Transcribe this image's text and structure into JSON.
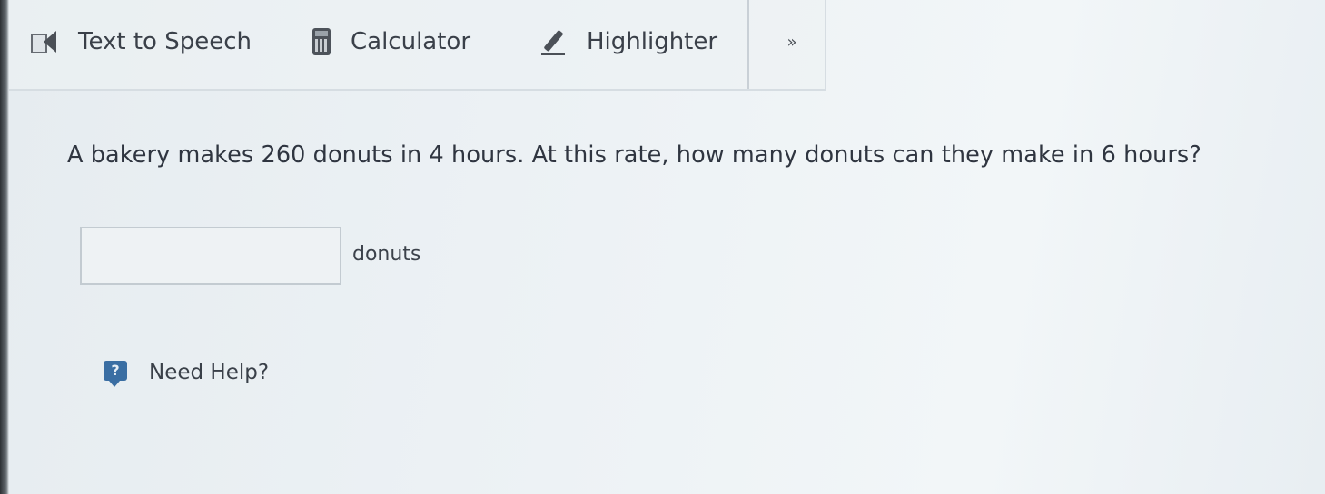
{
  "toolbar": {
    "text_to_speech_label": "Text to Speech",
    "calculator_label": "Calculator",
    "highlighter_label": "Highlighter",
    "more_label": "»"
  },
  "question": {
    "text": "A bakery makes 260 donuts in 4 hours. At this rate, how many donuts can they make in 6 hours?",
    "answer_value": "",
    "answer_unit": "donuts"
  },
  "help": {
    "label": "Need Help?",
    "icon_glyph": "?"
  },
  "colors": {
    "background": "#e9eff3",
    "help_icon": "#3a6ea3",
    "text": "#2e3440"
  }
}
